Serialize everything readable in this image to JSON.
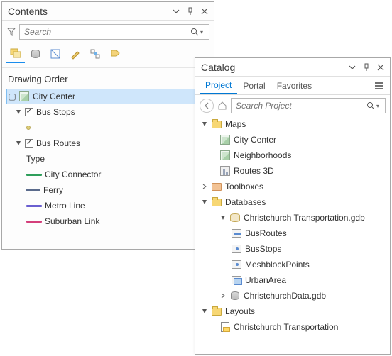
{
  "contents": {
    "title": "Contents",
    "search_placeholder": "Search",
    "section": "Drawing Order",
    "map_name": "City Center",
    "layer_bus_stops": "Bus Stops",
    "layer_bus_routes": "Bus Routes",
    "subhead_type": "Type",
    "legend": {
      "city_connector": "City Connector",
      "ferry": "Ferry",
      "metro_line": "Metro Line",
      "suburban_link": "Suburban Link"
    },
    "swatch_colors": {
      "city_connector": "#2e9e5b",
      "metro_line": "#6a5fd0",
      "suburban_link": "#d43f7b"
    }
  },
  "catalog": {
    "title": "Catalog",
    "tabs": {
      "project": "Project",
      "portal": "Portal",
      "favorites": "Favorites"
    },
    "search_placeholder": "Search Project",
    "maps": {
      "label": "Maps",
      "items": {
        "city_center": "City Center",
        "neighborhoods": "Neighborhoods",
        "routes_3d": "Routes 3D"
      }
    },
    "toolboxes": "Toolboxes",
    "databases": {
      "label": "Databases",
      "gdb1": {
        "label": "Christchurch Transportation.gdb",
        "fc": {
          "busroutes": "BusRoutes",
          "busstops": "BusStops",
          "meshblock": "MeshblockPoints",
          "urban": "UrbanArea"
        }
      },
      "gdb2": "ChristchurchData.gdb"
    },
    "layouts": {
      "label": "Layouts",
      "item1": "Christchurch Transportation"
    }
  }
}
